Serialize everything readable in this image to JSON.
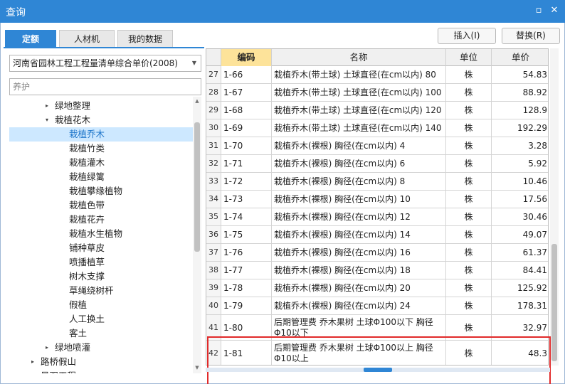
{
  "window": {
    "title": "查询",
    "restore_glyph": "▫",
    "close_glyph": "✕"
  },
  "tabs": [
    {
      "label": "定额",
      "active": true
    },
    {
      "label": "人材机",
      "active": false
    },
    {
      "label": "我的数据",
      "active": false
    }
  ],
  "actions": {
    "insert_label": "插入(I)",
    "replace_label": "替换(R)"
  },
  "quota_library": {
    "selected": "河南省园林工程工程量清单综合单价(2008)"
  },
  "search": {
    "value": "养护"
  },
  "tree": [
    {
      "label": "绿地整理",
      "level": 1,
      "toggle": "▸",
      "selected": false
    },
    {
      "label": "栽植花木",
      "level": 1,
      "toggle": "▾",
      "selected": false
    },
    {
      "label": "栽植乔木",
      "level": 2,
      "toggle": "",
      "selected": true
    },
    {
      "label": "栽植竹类",
      "level": 2,
      "toggle": "",
      "selected": false
    },
    {
      "label": "栽植灌木",
      "level": 2,
      "toggle": "",
      "selected": false
    },
    {
      "label": "栽植绿篱",
      "level": 2,
      "toggle": "",
      "selected": false
    },
    {
      "label": "栽植攀缘植物",
      "level": 2,
      "toggle": "",
      "selected": false
    },
    {
      "label": "栽植色带",
      "level": 2,
      "toggle": "",
      "selected": false
    },
    {
      "label": "栽植花卉",
      "level": 2,
      "toggle": "",
      "selected": false
    },
    {
      "label": "栽植水生植物",
      "level": 2,
      "toggle": "",
      "selected": false
    },
    {
      "label": "铺种草皮",
      "level": 2,
      "toggle": "",
      "selected": false
    },
    {
      "label": "喷播植草",
      "level": 2,
      "toggle": "",
      "selected": false
    },
    {
      "label": "树木支撑",
      "level": 2,
      "toggle": "",
      "selected": false
    },
    {
      "label": "草绳绕树杆",
      "level": 2,
      "toggle": "",
      "selected": false
    },
    {
      "label": "假植",
      "level": 2,
      "toggle": "",
      "selected": false
    },
    {
      "label": "人工换土",
      "level": 2,
      "toggle": "",
      "selected": false
    },
    {
      "label": "客土",
      "level": 2,
      "toggle": "",
      "selected": false
    },
    {
      "label": "绿地喷灌",
      "level": 1,
      "toggle": "▸",
      "selected": false
    },
    {
      "label": "路桥假山",
      "level": 0,
      "toggle": "▸",
      "selected": false
    },
    {
      "label": "景观工程",
      "level": 0,
      "toggle": "▸",
      "selected": false
    }
  ],
  "table": {
    "columns": {
      "code": "编码",
      "name": "名称",
      "unit": "单位",
      "price": "单价"
    },
    "rows": [
      {
        "idx": "27",
        "code": "1-66",
        "name": "栽植乔木(带土球) 土球直径(在cm以内) 80",
        "unit": "株",
        "price": "54.83"
      },
      {
        "idx": "28",
        "code": "1-67",
        "name": "栽植乔木(带土球) 土球直径(在cm以内) 100",
        "unit": "株",
        "price": "88.92"
      },
      {
        "idx": "29",
        "code": "1-68",
        "name": "栽植乔木(带土球) 土球直径(在cm以内) 120",
        "unit": "株",
        "price": "128.9"
      },
      {
        "idx": "30",
        "code": "1-69",
        "name": "栽植乔木(带土球) 土球直径(在cm以内) 140",
        "unit": "株",
        "price": "192.29"
      },
      {
        "idx": "31",
        "code": "1-70",
        "name": "栽植乔木(裸根) 胸径(在cm以内) 4",
        "unit": "株",
        "price": "3.28"
      },
      {
        "idx": "32",
        "code": "1-71",
        "name": "栽植乔木(裸根) 胸径(在cm以内) 6",
        "unit": "株",
        "price": "5.92"
      },
      {
        "idx": "33",
        "code": "1-72",
        "name": "栽植乔木(裸根) 胸径(在cm以内) 8",
        "unit": "株",
        "price": "10.46"
      },
      {
        "idx": "34",
        "code": "1-73",
        "name": "栽植乔木(裸根) 胸径(在cm以内) 10",
        "unit": "株",
        "price": "17.56"
      },
      {
        "idx": "35",
        "code": "1-74",
        "name": "栽植乔木(裸根) 胸径(在cm以内) 12",
        "unit": "株",
        "price": "30.46"
      },
      {
        "idx": "36",
        "code": "1-75",
        "name": "栽植乔木(裸根) 胸径(在cm以内) 14",
        "unit": "株",
        "price": "49.07"
      },
      {
        "idx": "37",
        "code": "1-76",
        "name": "栽植乔木(裸根) 胸径(在cm以内) 16",
        "unit": "株",
        "price": "61.37"
      },
      {
        "idx": "38",
        "code": "1-77",
        "name": "栽植乔木(裸根) 胸径(在cm以内) 18",
        "unit": "株",
        "price": "84.41"
      },
      {
        "idx": "39",
        "code": "1-78",
        "name": "栽植乔木(裸根) 胸径(在cm以内) 20",
        "unit": "株",
        "price": "125.92"
      },
      {
        "idx": "40",
        "code": "1-79",
        "name": "栽植乔木(裸根) 胸径(在cm以内) 24",
        "unit": "株",
        "price": "178.31"
      },
      {
        "idx": "41",
        "code": "1-80",
        "name": "后期管理费 乔木果树 土球Φ100以下 胸径Φ10以下",
        "unit": "株",
        "price": "32.97"
      },
      {
        "idx": "42",
        "code": "1-81",
        "name": "后期管理费 乔木果树 土球Φ100以上 胸径Φ10以上",
        "unit": "株",
        "price": "48.3"
      }
    ]
  },
  "colors": {
    "accent": "#2f86d5",
    "highlight_box": "#e12a2a",
    "code_header": "#fde39a",
    "tree_selected": "#cde8ff"
  }
}
